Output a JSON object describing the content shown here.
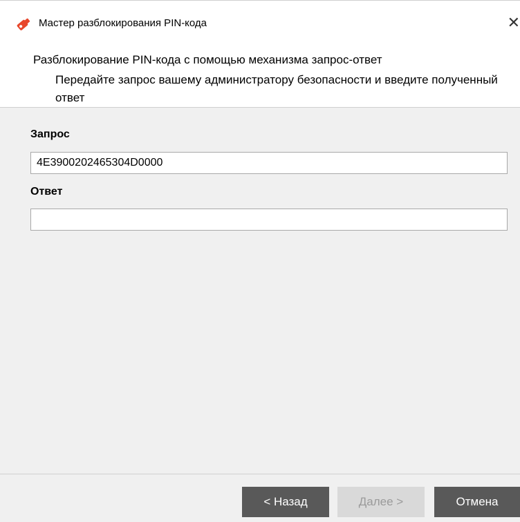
{
  "window": {
    "title": "Мастер разблокирования PIN-кода",
    "close_glyph": "✕",
    "app_icon": "key-icon",
    "accent_color": "#e8472b"
  },
  "header": {
    "title": "Разблокирование PIN-кода с помощью механизма запрос-ответ",
    "description": "Передайте запрос вашему администратору безопасности и введите полученный ответ"
  },
  "form": {
    "request_label": "Запрос",
    "request_value": "4E3900202465304D0000",
    "response_label": "Ответ",
    "response_value": ""
  },
  "footer": {
    "back_label": "< Назад",
    "next_label": "Далее >",
    "cancel_label": "Отмена",
    "next_enabled": false
  }
}
